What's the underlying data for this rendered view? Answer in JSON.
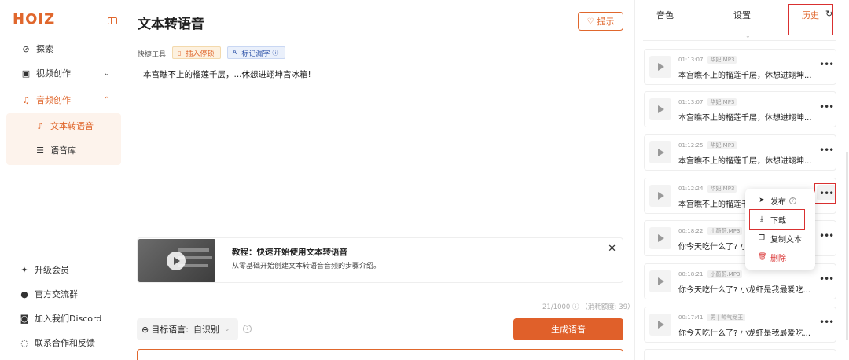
{
  "sidebar": {
    "logo": "HOIZ",
    "items": [
      {
        "label": "探索",
        "icon": "compass-icon"
      },
      {
        "label": "视频创作",
        "icon": "video-icon"
      },
      {
        "label": "音频创作",
        "icon": "audio-icon"
      }
    ],
    "sub_items": [
      {
        "label": "文本转语音",
        "icon": "mic-icon"
      },
      {
        "label": "语音库",
        "icon": "list-icon"
      }
    ],
    "bottom": [
      {
        "label": "升级会员",
        "icon": "sparkle-icon"
      },
      {
        "label": "官方交流群",
        "icon": "bell-icon"
      },
      {
        "label": "加入我们Discord",
        "icon": "discord-icon"
      },
      {
        "label": "联系合作和反馈",
        "icon": "chat-icon"
      }
    ]
  },
  "main": {
    "title": "文本转语音",
    "tip_label": "提示",
    "shortcut_label": "快捷工具:",
    "chip_pause": "插入停顿",
    "chip_mark": "标记漏字",
    "editor_text": "本宫瞧不上的榴莲千层，...休想进翊坤宫冰箱!",
    "tutorial": {
      "title": "教程：快速开始使用文本转语音",
      "desc": "从零基础开始创建文本转语音音频的步骤介绍。"
    },
    "counter": "21/1000 ⓘ （消耗额度: 39）",
    "target_lang_label": "目标语言:",
    "target_lang_value": "自识别",
    "generate_label": "生成语音"
  },
  "right": {
    "tabs": [
      "音色",
      "设置",
      "历史"
    ],
    "active_tab": "历史",
    "history": [
      {
        "time": "01:13:07",
        "tag": "华妃.MP3",
        "text": "本宫瞧不上的榴莲千层，休想进翊坤..."
      },
      {
        "time": "01:13:07",
        "tag": "华妃.MP3",
        "text": "本宫瞧不上的榴莲千层，休想进翊坤..."
      },
      {
        "time": "01:12:25",
        "tag": "华妃.MP3",
        "text": "本宫瞧不上的榴莲千层，休想进翊坤..."
      },
      {
        "time": "01:12:24",
        "tag": "华妃.MP3",
        "text": "本宫瞧不上的榴莲千"
      },
      {
        "time": "00:18:22",
        "tag": "小蔚蔚.MP3",
        "text": "你今天吃什么了? 小"
      },
      {
        "time": "00:18:21",
        "tag": "小蔚蔚.MP3",
        "text": "你今天吃什么了? 小龙虾是我最爱吃..."
      },
      {
        "time": "00:17:41",
        "tag": "男 | 帅气龙王",
        "text": "你今天吃什么了? 小龙虾是我最爱吃..."
      }
    ],
    "menu": {
      "publish": "发布",
      "download": "下载",
      "copy": "复制文本",
      "delete": "删除"
    }
  },
  "colors": {
    "accent": "#e0672d",
    "highlight": "#d93030"
  }
}
